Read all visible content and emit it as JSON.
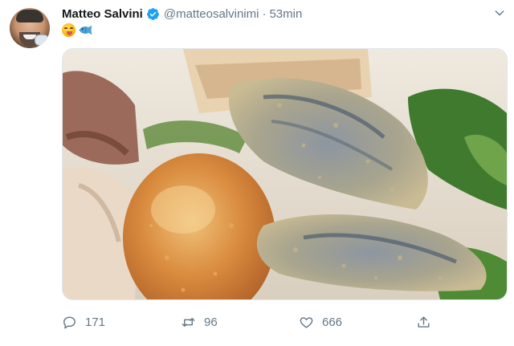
{
  "tweet": {
    "author_name": "Matteo Salvini",
    "handle": "@matteosalvinimi",
    "separator": "·",
    "time": "53min",
    "verified": true,
    "text_emojis": [
      "savoring-food-emoji",
      "fish-emoji"
    ]
  },
  "actions": {
    "replies": "171",
    "retweets": "96",
    "likes": "666"
  },
  "colors": {
    "accent": "#1da1f2",
    "muted": "#657786",
    "text": "#14171a"
  },
  "icons": [
    "verified-badge-icon",
    "chevron-down-icon",
    "reply-icon",
    "retweet-icon",
    "heart-icon",
    "share-icon"
  ]
}
